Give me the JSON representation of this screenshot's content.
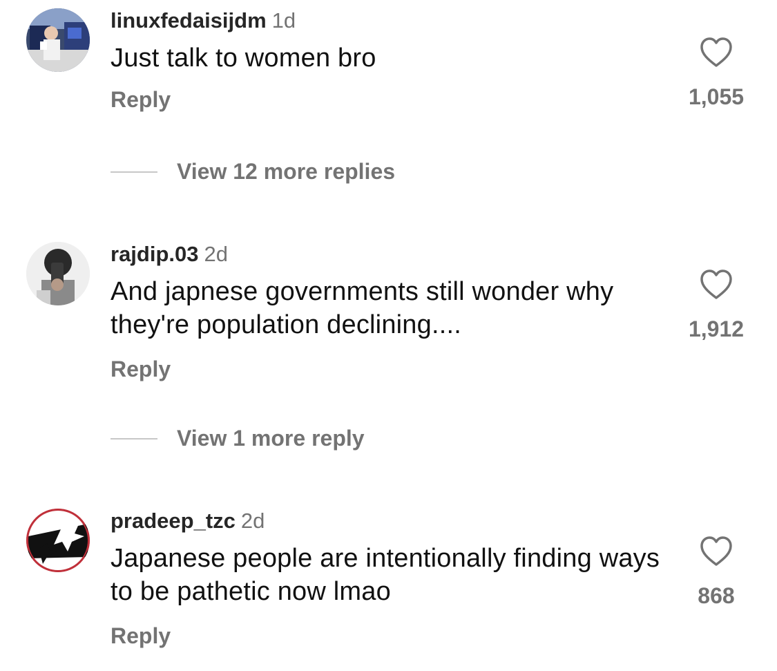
{
  "comments": [
    {
      "username": "linuxfedaisijdm",
      "time": "1d",
      "text": "Just talk to women bro",
      "reply_label": "Reply",
      "likes": "1,055",
      "avatar_icon": "photo-avatar",
      "view_replies": "View 12 more replies"
    },
    {
      "username": "rajdip.03",
      "time": "2d",
      "text": "And japnese governments still wonder why they're population  declining....",
      "reply_label": "Reply",
      "likes": "1,912",
      "avatar_icon": "photo-avatar",
      "view_replies": "View 1 more reply"
    },
    {
      "username": "pradeep_tzc",
      "time": "2d",
      "text": "Japanese people are intentionally finding ways to be pathetic now lmao",
      "reply_label": "Reply",
      "likes": "868",
      "avatar_icon": "bird-logo-avatar"
    }
  ],
  "icons": {
    "like": "heart-outline-icon"
  },
  "colors": {
    "text": "#111111",
    "secondary": "#737373",
    "divider": "#c7c7c7"
  }
}
